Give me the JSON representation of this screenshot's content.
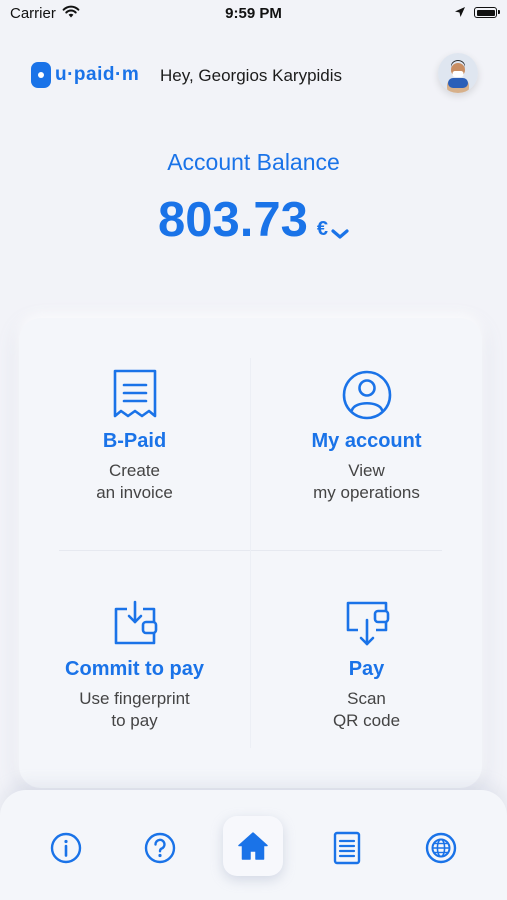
{
  "status_bar": {
    "carrier": "Carrier",
    "time": "9:59 PM"
  },
  "header": {
    "logo_text": "u·paid·m",
    "greeting": "Hey, Georgios Karypidis"
  },
  "balance": {
    "label": "Account Balance",
    "amount": "803.73",
    "currency": "€"
  },
  "tiles": [
    {
      "title": "B-Paid",
      "line1": "Create",
      "line2": "an invoice",
      "icon": "receipt-icon"
    },
    {
      "title": "My account",
      "line1": "View",
      "line2": "my operations",
      "icon": "user-circle-icon"
    },
    {
      "title": "Commit to pay",
      "line1": "Use fingerprint",
      "line2": "to pay",
      "icon": "wallet-download-icon"
    },
    {
      "title": "Pay",
      "line1": "Scan",
      "line2": "QR code",
      "icon": "wallet-scan-icon"
    }
  ],
  "tabbar": {
    "items": [
      "info-icon",
      "help-icon",
      "home-icon",
      "document-icon",
      "globe-icon"
    ],
    "active": "home-icon"
  },
  "colors": {
    "accent": "#1a73e8",
    "background": "#f2f3f8"
  }
}
